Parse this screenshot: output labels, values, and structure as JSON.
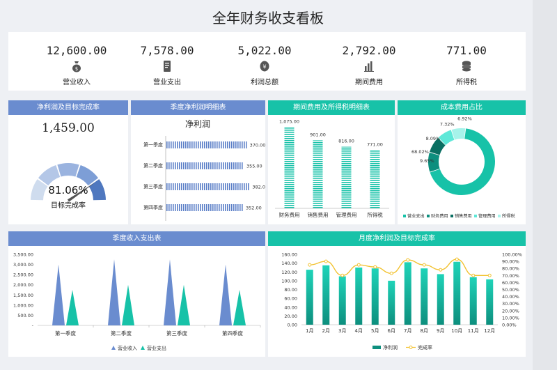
{
  "page_title": "全年财务收支看板",
  "kpis": [
    {
      "value": "12,600.00",
      "label": "营业收入",
      "icon": "money-bag-icon"
    },
    {
      "value": "7,578.00",
      "label": "营业支出",
      "icon": "receipt-icon"
    },
    {
      "value": "5,022.00",
      "label": "利润总额",
      "icon": "coin-icon"
    },
    {
      "value": "2,792.00",
      "label": "期间费用",
      "icon": "bar-chart-icon"
    },
    {
      "value": "771.00",
      "label": "所得税",
      "icon": "coin-stack-icon"
    }
  ],
  "colors": {
    "blue": "#6a8ccf",
    "teal": "#17c2a8",
    "dark_teal": "#0d8f7e"
  },
  "chart_data": [
    {
      "type": "gauge",
      "header": "净利润及目标完成率",
      "value_text": "1,459.00",
      "percent_text": "81.06%",
      "percent": 81.06,
      "label": "目标完成率"
    },
    {
      "type": "bar",
      "header": "季度净利润明细表",
      "title": "净利润",
      "categories": [
        "第一季度",
        "第二季度",
        "第三季度",
        "第四季度"
      ],
      "values": [
        370,
        355,
        382,
        352
      ],
      "value_labels": [
        "370.00",
        "355.00",
        "382.00",
        "352.00"
      ],
      "xlim": [
        0,
        400
      ]
    },
    {
      "type": "bar",
      "header": "期间费用及所得税明细表",
      "categories": [
        "财务费用",
        "销售费用",
        "管理费用",
        "所得税"
      ],
      "values": [
        1075,
        901,
        816,
        771
      ],
      "value_labels": [
        "1,075.00",
        "901.00",
        "816.00",
        "771.00"
      ],
      "ylim": [
        0,
        1200
      ]
    },
    {
      "type": "pie",
      "header": "成本费用占比",
      "labels": [
        "营业支出",
        "财务费用",
        "销售费用",
        "管理费用",
        "所得税"
      ],
      "values": [
        68.02,
        9.65,
        8.09,
        7.32,
        6.92
      ],
      "value_labels": [
        "68.02%",
        "9.65%",
        "8.09%",
        "7.32%",
        "6.92%"
      ],
      "colors": [
        "#17c2a8",
        "#0d8f7e",
        "#0a6f62",
        "#5ee8d8",
        "#a6f3ea"
      ]
    },
    {
      "type": "area",
      "header": "季度收入支出表",
      "categories": [
        "第一季度",
        "第二季度",
        "第三季度",
        "第四季度"
      ],
      "series": [
        {
          "name": "营业收入",
          "values": [
            3000,
            3250,
            3250,
            3000
          ]
        },
        {
          "name": "营业支出",
          "values": [
            1750,
            2000,
            2000,
            1750
          ]
        }
      ],
      "yticks": [
        "3,500.00",
        "3,000.00",
        "2,500.00",
        "2,000.00",
        "1,500.00",
        "1,000.00",
        "500.00",
        "-"
      ],
      "ylim": [
        0,
        3500
      ]
    },
    {
      "type": "bar",
      "header": "月度净利润及目标完成率",
      "categories": [
        "1月",
        "2月",
        "3月",
        "4月",
        "5月",
        "6月",
        "7月",
        "8月",
        "9月",
        "10月",
        "11月",
        "12月"
      ],
      "series": [
        {
          "name": "净利润",
          "values": [
            125,
            135,
            110,
            130,
            128,
            100,
            142,
            128,
            115,
            143,
            108,
            103
          ]
        },
        {
          "name": "完成率",
          "values": [
            85,
            90,
            70,
            85,
            82,
            73,
            92,
            85,
            78,
            93,
            70,
            70
          ]
        }
      ],
      "yticks_left": [
        "160.00",
        "140.00",
        "120.00",
        "100.00",
        "80.00",
        "60.00",
        "40.00",
        "20.00",
        "0.00"
      ],
      "yticks_right": [
        "100.00%",
        "90.00%",
        "80.00%",
        "70.00%",
        "60.00%",
        "50.00%",
        "40.00%",
        "30.00%",
        "20.00%",
        "10.00%",
        "0.00%"
      ],
      "ylim_left": [
        0,
        160
      ],
      "ylim_right": [
        0,
        100
      ]
    }
  ]
}
